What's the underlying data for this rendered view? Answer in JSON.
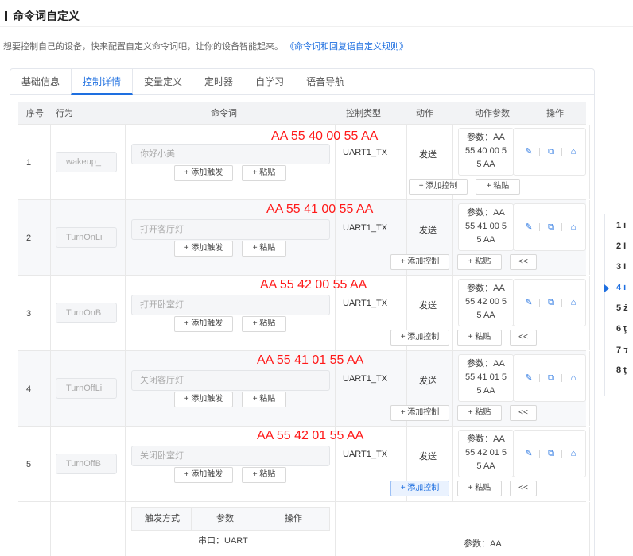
{
  "header": {
    "title": "命令词自定义"
  },
  "desc": {
    "text": "想要控制自己的设备，快来配置自定义命令词吧，让你的设备智能起来。",
    "link": "《命令词和回复语自定义规则》"
  },
  "tabs": [
    "基础信息",
    "控制详情",
    "变量定义",
    "定时器",
    "自学习",
    "语音导航"
  ],
  "table": {
    "headers": {
      "no": "序号",
      "action": "行为",
      "cmd": "命令词",
      "ctype": "控制类型",
      "act": "动作",
      "params": "动作参数",
      "ops": "操作"
    },
    "add_trigger": "+ 添加触发",
    "paste": "+ 粘贴",
    "add_control": "+ 添加控制",
    "collapse": "<<",
    "rows": [
      {
        "no": "1",
        "behavior": "wakeup_",
        "cmd": "你好小美",
        "ctype": "UART1_TX",
        "act": "发送",
        "param": [
          "参数：AA",
          "55 40 00 5",
          "5 AA"
        ],
        "hex": "AA 55 40 00 55 AA"
      },
      {
        "no": "2",
        "behavior": "TurnOnLi",
        "cmd": "打开客厅灯",
        "ctype": "UART1_TX",
        "act": "发送",
        "param": [
          "参数：AA",
          "55 41 00 5",
          "5 AA"
        ],
        "hex": "AA 55 41 00 55 AA"
      },
      {
        "no": "3",
        "behavior": "TurnOnB",
        "cmd": "打开卧室灯",
        "ctype": "UART1_TX",
        "act": "发送",
        "param": [
          "参数：AA",
          "55 42 00 5",
          "5 AA"
        ],
        "hex": "AA 55 42 00 55 AA"
      },
      {
        "no": "4",
        "behavior": "TurnOffLi",
        "cmd": "关闭客厅灯",
        "ctype": "UART1_TX",
        "act": "发送",
        "param": [
          "参数：AA",
          "55 41 01 5",
          "5 AA"
        ],
        "hex": "AA 55 41 01 55 AA"
      },
      {
        "no": "5",
        "behavior": "TurnOffB",
        "cmd": "关闭卧室灯",
        "ctype": "UART1_TX",
        "act": "发送",
        "param": [
          "参数：AA",
          "55 42 01 5",
          "5 AA"
        ],
        "hex": "AA 55 42 01 55 AA"
      }
    ],
    "sub_headers": {
      "mode": "触发方式",
      "param": "参数",
      "op": "操作"
    },
    "partial": {
      "port": "串口：UART",
      "param": "参数：AA"
    }
  },
  "outline": [
    "1 i",
    "2 I",
    "3 I",
    "4 i",
    "5 ż",
    "6 ţ",
    "7 ⁊",
    "8 ţ"
  ],
  "colors": {
    "accent": "#1e6fe0",
    "annotation": "#ff1a1a"
  }
}
